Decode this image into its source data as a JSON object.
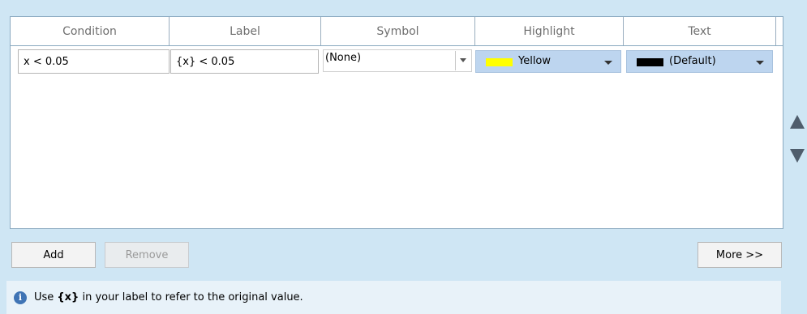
{
  "columns": [
    "Condition",
    "Label",
    "Symbol",
    "Highlight",
    "Text"
  ],
  "row": {
    "condition": "x < 0.05",
    "label": "{x} < 0.05",
    "symbol": "(None)",
    "highlight": {
      "name": "Yellow",
      "color": "#ffff00"
    },
    "text": {
      "name": "(Default)",
      "color": "#000000"
    }
  },
  "buttons": {
    "add": "Add",
    "remove": "Remove",
    "more": "More >>"
  },
  "reorder": {
    "up_icon": "triangle-up-icon",
    "down_icon": "triangle-down-icon"
  },
  "info": {
    "prefix": "Use ",
    "token": "{x}",
    "suffix": " in your label to refer to the original value."
  }
}
